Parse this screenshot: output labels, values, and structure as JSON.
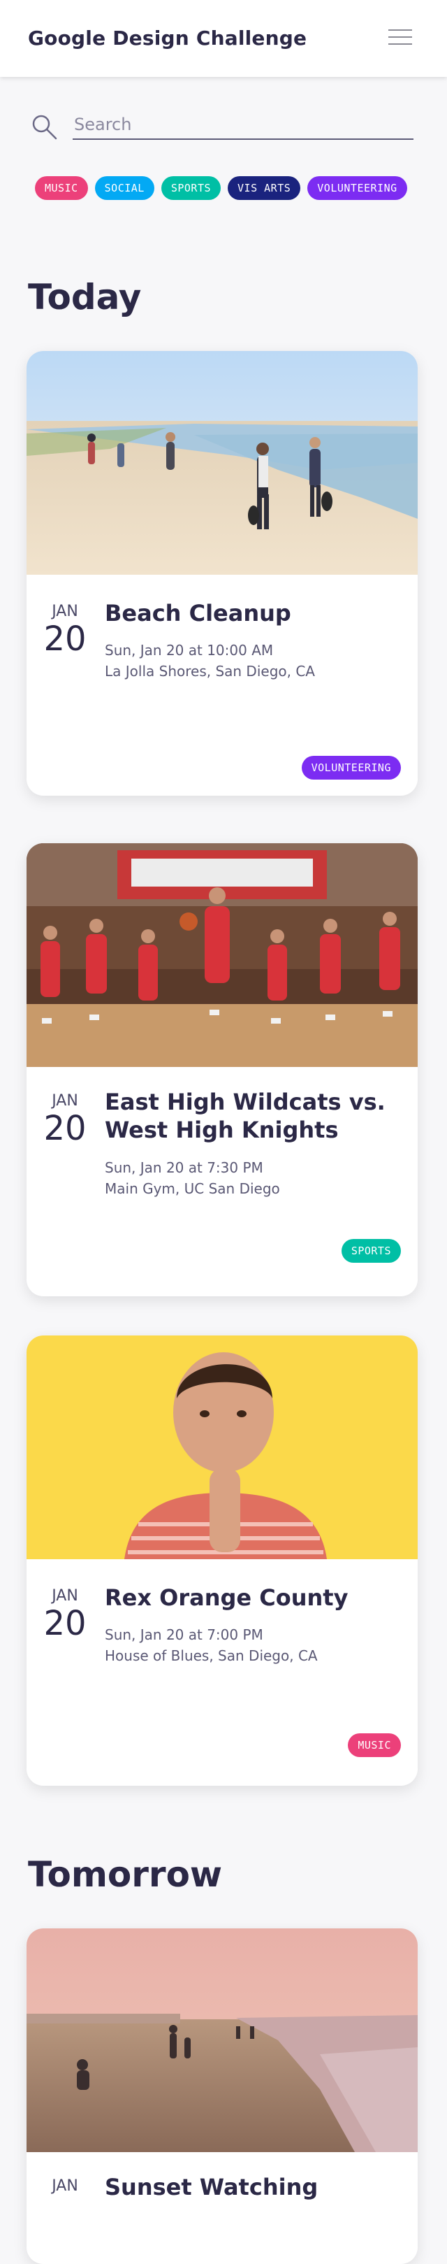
{
  "header": {
    "title": "Google Design Challenge",
    "menu_icon": "hamburger-menu-icon"
  },
  "search": {
    "placeholder": "Search",
    "value": ""
  },
  "categories": [
    {
      "label": "MUSIC",
      "color": "#ec407a"
    },
    {
      "label": "SOCIAL",
      "color": "#03a9f4"
    },
    {
      "label": "SPORTS",
      "color": "#00bfa5"
    },
    {
      "label": "VIS ARTS",
      "color": "#1a237e"
    },
    {
      "label": "VOLUNTEERING",
      "color": "#7c2cf2"
    }
  ],
  "sections": {
    "today": "Today",
    "tomorrow": "Tomorrow"
  },
  "events": [
    {
      "month": "JAN",
      "day": "20",
      "title": "Beach Cleanup",
      "time": "Sun, Jan 20 at 10:00 AM",
      "location": "La Jolla Shores, San Diego, CA",
      "tag": "VOLUNTEERING",
      "tag_color": "#7c2cf2"
    },
    {
      "month": "JAN",
      "day": "20",
      "title": "East High Wildcats vs. West High Knights",
      "time": "Sun, Jan 20 at 7:30 PM",
      "location": "Main Gym, UC San Diego",
      "tag": "SPORTS",
      "tag_color": "#00bfa5"
    },
    {
      "month": "JAN",
      "day": "20",
      "title": "Rex Orange County",
      "time": "Sun, Jan 20 at 7:00 PM",
      "location": "House of Blues, San Diego, CA",
      "tag": "MUSIC",
      "tag_color": "#ec407a"
    },
    {
      "month": "JAN",
      "title": "Sunset Watching"
    }
  ]
}
